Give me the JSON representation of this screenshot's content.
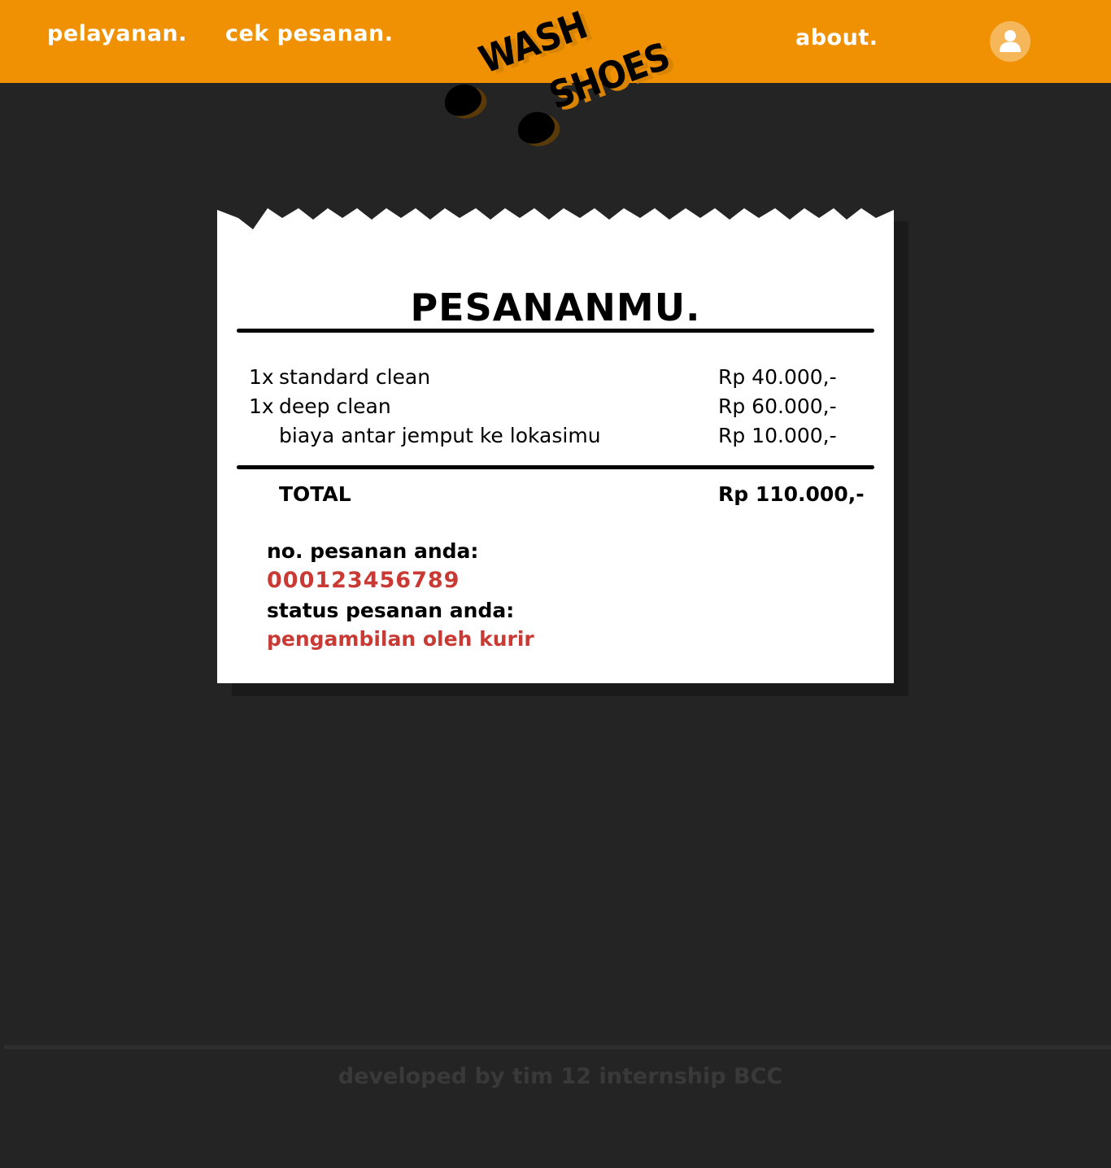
{
  "nav": {
    "links": [
      "pelayanan.",
      "cek pesanan.",
      "about."
    ]
  },
  "logo": {
    "line1": "WASH",
    "line2": "SHOES"
  },
  "colors": {
    "header": "#ef9102",
    "background": "#252425",
    "accent_red": "#c93a35"
  },
  "receipt": {
    "title": "PESANANMU.",
    "items": [
      {
        "qty": "1x",
        "name": "standard clean",
        "price": "Rp 40.000,-"
      },
      {
        "qty": "1x",
        "name": "deep clean",
        "price": "Rp 60.000,-"
      },
      {
        "qty": "",
        "name": "biaya antar jemput ke lokasimu",
        "price": "Rp 10.000,-"
      }
    ],
    "total": {
      "label": "TOTAL",
      "price": "Rp 110.000,-"
    },
    "order_number_label": "no. pesanan anda:",
    "order_number": "000123456789",
    "status_label": "status pesanan anda:",
    "status": "pengambilan oleh kurir"
  },
  "footer": {
    "text": "developed by tim 12 internship BCC"
  }
}
